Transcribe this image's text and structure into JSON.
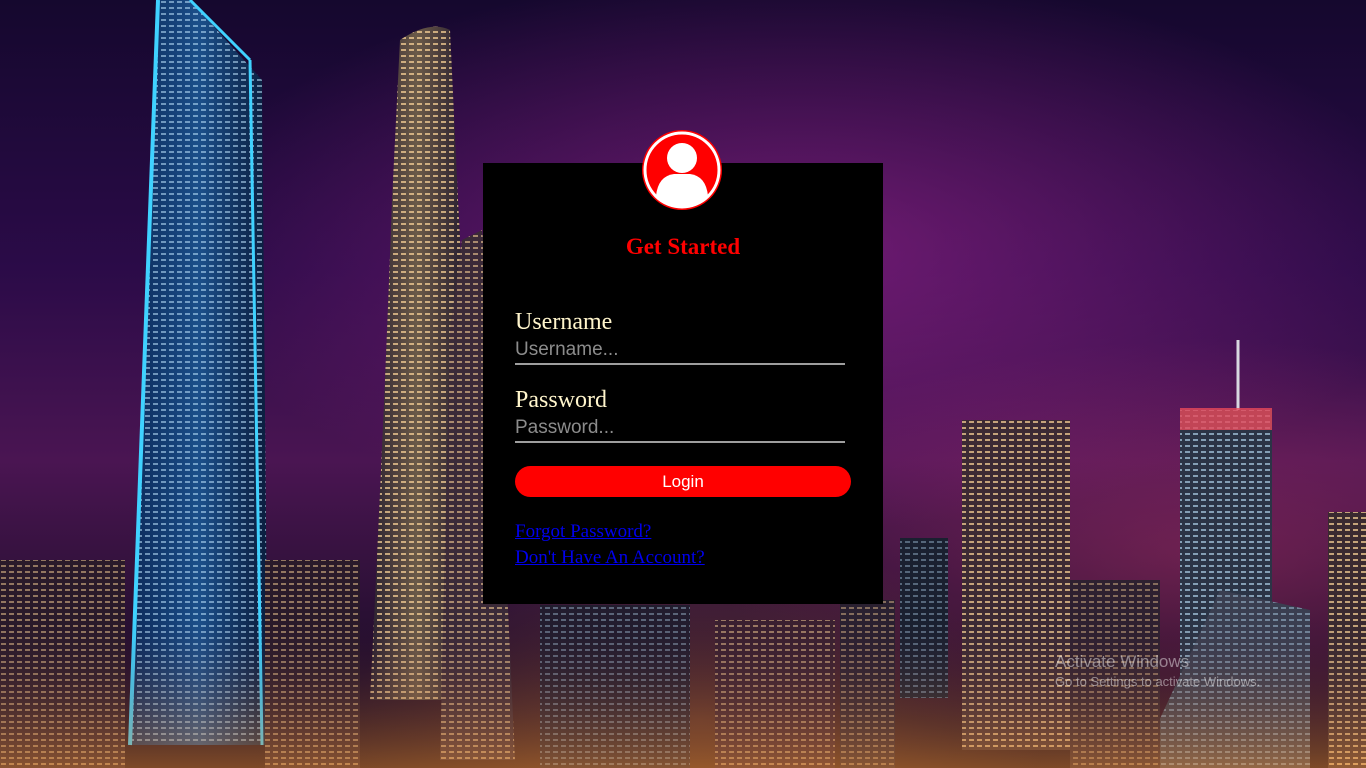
{
  "login": {
    "title": "Get Started",
    "username_label": "Username",
    "username_placeholder": "Username...",
    "username_value": "",
    "password_label": "Password",
    "password_placeholder": "Password...",
    "password_value": "",
    "login_button": "Login",
    "forgot_link": "Forgot Password?",
    "signup_link": "Don't Have An Account?"
  },
  "avatar_icon": "user-icon",
  "colors": {
    "accent": "#ff0000",
    "card_bg": "#000000",
    "label": "#fff5cc",
    "link": "#0000ee"
  },
  "watermark": {
    "title": "Activate Windows",
    "subtitle": "Go to Settings to activate Windows."
  }
}
